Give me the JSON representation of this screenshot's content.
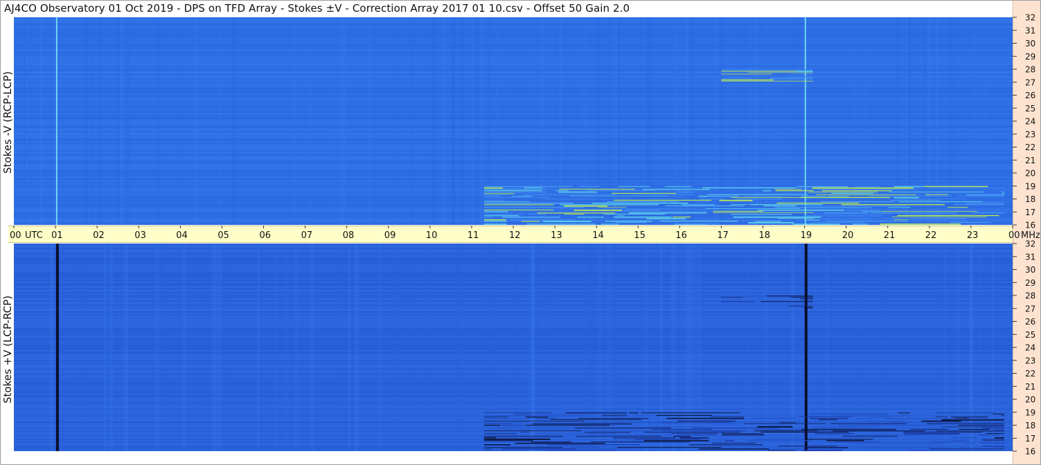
{
  "title": "AJ4CO Observatory  01 Oct 2019  -  DPS on TFD Array  -  Stokes ±V  -  Correction Array 2017 01 10.csv  -  Offset 50  Gain 2.0",
  "colors": {
    "base_blue": "#2f6fe6",
    "frame_right": "#fde3cf",
    "time_strip": "#fffdc8",
    "burst_light": "#c7f24a",
    "burst_dark": "#0a1030"
  },
  "chart_data": [
    {
      "type": "heatmap",
      "name": "Stokes -V (RCP-LCP)",
      "ylabel": "Stokes -V (RCP-LCP)",
      "xlabel": "UTC",
      "x_ticks": [
        "00",
        "01",
        "02",
        "03",
        "04",
        "05",
        "06",
        "07",
        "08",
        "09",
        "10",
        "11",
        "12",
        "13",
        "14",
        "15",
        "16",
        "17",
        "18",
        "19",
        "20",
        "21",
        "22",
        "23",
        "00"
      ],
      "x_unit_label": "UTC",
      "y_unit": "MHz",
      "y_ticks": [
        "32",
        "31",
        "30",
        "29",
        "28",
        "27",
        "26",
        "25",
        "24",
        "23",
        "22",
        "21",
        "20",
        "19",
        "18",
        "17",
        "16"
      ],
      "ylim": [
        16,
        32
      ],
      "xlim_hours": [
        0,
        24
      ],
      "features": [
        {
          "kind": "vertical_line",
          "hour": 1.03,
          "tone": "light"
        },
        {
          "kind": "vertical_line",
          "hour": 19.02,
          "tone": "light"
        },
        {
          "kind": "emission_band",
          "hour_start": 11.3,
          "hour_end": 23.8,
          "freq_low": 16,
          "freq_high": 19,
          "tone": "light"
        },
        {
          "kind": "emission_band",
          "hour_start": 17.0,
          "hour_end": 19.2,
          "freq_low": 27.0,
          "freq_high": 28.0,
          "tone": "light"
        }
      ]
    },
    {
      "type": "heatmap",
      "name": "Stokes +V (LCP-RCP)",
      "ylabel": "Stokes +V (LCP-RCP)",
      "xlabel": "UTC",
      "y_unit": "MHz",
      "y_ticks": [
        "32",
        "31",
        "30",
        "29",
        "28",
        "27",
        "26",
        "25",
        "24",
        "23",
        "22",
        "21",
        "20",
        "19",
        "18",
        "17",
        "16"
      ],
      "ylim": [
        16,
        32
      ],
      "xlim_hours": [
        0,
        24
      ],
      "features": [
        {
          "kind": "vertical_line",
          "hour": 1.03,
          "tone": "dark"
        },
        {
          "kind": "vertical_line",
          "hour": 19.02,
          "tone": "dark"
        },
        {
          "kind": "emission_band",
          "hour_start": 11.3,
          "hour_end": 23.8,
          "freq_low": 16,
          "freq_high": 19,
          "tone": "dark"
        },
        {
          "kind": "emission_band",
          "hour_start": 17.0,
          "hour_end": 19.2,
          "freq_low": 27.0,
          "freq_high": 28.0,
          "tone": "dark"
        }
      ]
    }
  ],
  "axis": {
    "utc_label": "UTC",
    "mhz_label": "MHz"
  }
}
